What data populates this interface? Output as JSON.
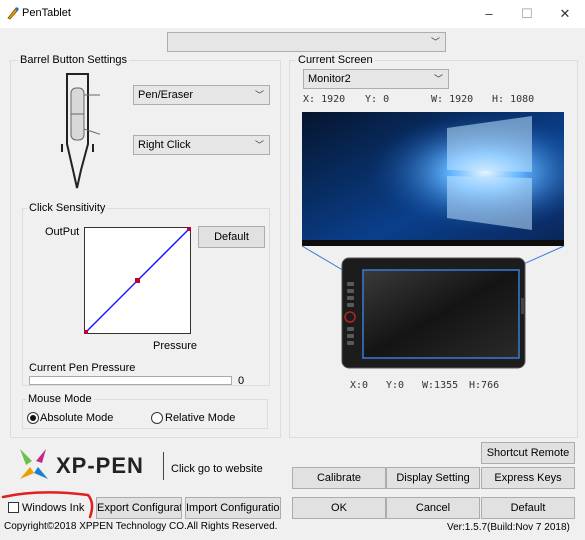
{
  "window": {
    "title": "PenTablet",
    "minimize": "–",
    "maximize": "☐",
    "close": "✕"
  },
  "top_combo": {
    "value": ""
  },
  "barrel": {
    "label": "Barrel Button Settings",
    "upper_button": "Pen/Eraser",
    "lower_button": "Right Click"
  },
  "sensitivity": {
    "label": "Click Sensitivity",
    "output_label": "OutPut",
    "pressure_label": "Pressure",
    "default_button": "Default",
    "curve": [
      [
        0,
        0
      ],
      [
        0.5,
        0.5
      ],
      [
        1,
        1
      ]
    ]
  },
  "pen_pressure": {
    "label": "Current Pen Pressure",
    "value": "0",
    "fraction": 0
  },
  "mouse_mode": {
    "label": "Mouse Mode",
    "absolute": "Absolute Mode",
    "relative": "Relative Mode",
    "selected": "absolute"
  },
  "screen": {
    "label": "Current Screen",
    "monitor": "Monitor2",
    "x_label": "X:",
    "x": "1920",
    "y_label": "Y:",
    "y": "0",
    "w_label": "W:",
    "w": "1920",
    "h_label": "H:",
    "h": "1080"
  },
  "tablet_area": {
    "x_label": "X:",
    "x": "0",
    "y_label": "Y:",
    "y": "0",
    "w_label": "W:",
    "w": "1355",
    "h_label": "H:",
    "h": "766"
  },
  "logo": {
    "text": "XP-PEN",
    "link": "Click go to website"
  },
  "buttons": {
    "shortcut_remote": "Shortcut Remote",
    "calibrate": "Calibrate",
    "display_setting": "Display Setting",
    "express_keys": "Express Keys",
    "export_config": "Export Configuration",
    "import_config": "Import Configuration",
    "ok": "OK",
    "cancel": "Cancel",
    "default": "Default"
  },
  "windows_ink": {
    "label": "Windows Ink",
    "checked": false
  },
  "footer": {
    "copyright": "Copyright©2018  XPPEN Technology CO.All Rights Reserved.",
    "version": "Ver:1.5.7(Build:Nov  7 2018)"
  },
  "colors": {
    "accent": "#0078d7",
    "curve": "#1a1aff",
    "point": "#c0003a",
    "annotation": "#e02020"
  }
}
